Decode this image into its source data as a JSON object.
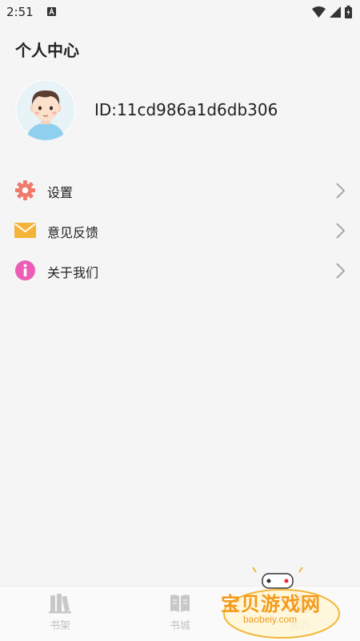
{
  "status_bar": {
    "time": "2:51",
    "icons": [
      "a-notification-icon",
      "wifi-icon",
      "signal-icon",
      "battery-icon"
    ]
  },
  "page_title": "个人中心",
  "profile": {
    "id_text": "ID:11cd986a1d6db306",
    "avatar": "avatar-boy"
  },
  "menu": [
    {
      "label": "设置",
      "icon": "gear-icon",
      "color": "#f07a6b"
    },
    {
      "label": "意见反馈",
      "icon": "mail-icon",
      "color": "#f4b43a"
    },
    {
      "label": "关于我们",
      "icon": "info-icon",
      "color": "#ee5db5"
    }
  ],
  "tabs": [
    {
      "label": "书架",
      "icon": "bookshelf-icon"
    },
    {
      "label": "书城",
      "icon": "book-open-icon"
    },
    {
      "label": "我的",
      "icon": "user-icon"
    }
  ],
  "watermark": {
    "text": "宝贝游戏网",
    "subtext": "baobeiy.com"
  }
}
